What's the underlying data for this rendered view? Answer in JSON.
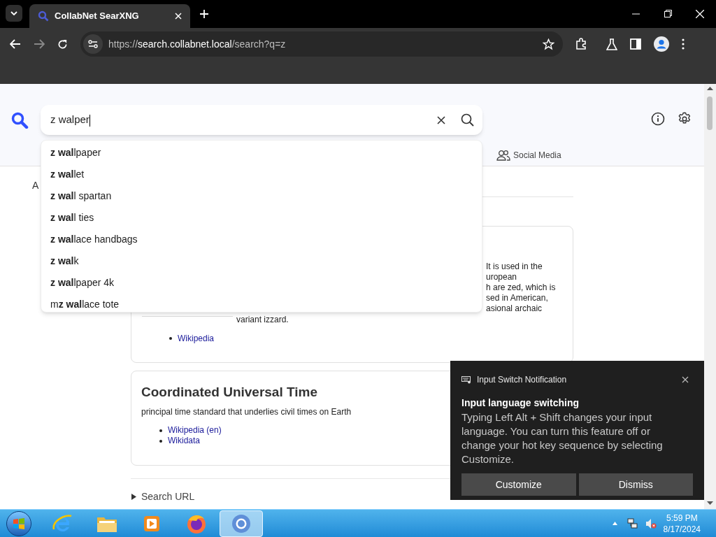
{
  "browser": {
    "tab_title": "CollabNet SearXNG",
    "url": {
      "scheme": "https://",
      "host": "search.collabnet.local",
      "path": "/search?q=z"
    }
  },
  "search": {
    "value": "z walper"
  },
  "suggestions": [
    {
      "text": "**z wal**lpaper"
    },
    {
      "text": "**z wal**let"
    },
    {
      "text": "**z wal**l spartan"
    },
    {
      "text": "**z wal**l ties"
    },
    {
      "text": "**z wal**lace handbags"
    },
    {
      "text": "**z wal**k"
    },
    {
      "text": "**z wal**lpaper 4k"
    },
    {
      "text": "m**z wal**lace tote"
    }
  ],
  "categories": [
    {
      "label": "Social Media"
    }
  ],
  "answer_fragment": "A",
  "infobox_fragment": {
    "lines": [
      "It is used in the",
      "uropean",
      "h are zed, which is",
      "sed in American,",
      "asional archaic"
    ],
    "last_line": "variant izzard.",
    "links": [
      "Wikipedia"
    ]
  },
  "infobox": {
    "title": "Coordinated Universal Time",
    "description": "principal time standard that underlies civil times on Earth",
    "links": [
      "Wikipedia (en)",
      "Wikidata"
    ]
  },
  "search_url": {
    "label": "Search URL",
    "expanded": false
  },
  "notification": {
    "app": "Input Switch Notification",
    "title": "Input language switching",
    "body": "Typing Left Alt + Shift changes your input language. You can turn this feature off or change your hot key sequence by selecting Customize.",
    "buttons": [
      "Customize",
      "Dismiss"
    ]
  },
  "taskbar": {
    "apps": [
      {
        "kind": "ie",
        "selected": false
      },
      {
        "kind": "folder",
        "selected": false
      },
      {
        "kind": "media",
        "selected": false
      },
      {
        "kind": "firefox",
        "selected": false
      },
      {
        "kind": "chrome",
        "selected": true
      }
    ],
    "time": "5:59 PM",
    "date": "8/17/2024"
  }
}
